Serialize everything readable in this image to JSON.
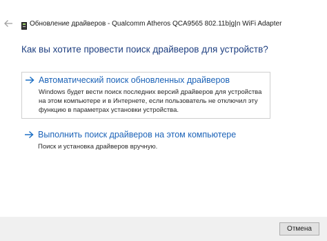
{
  "window": {
    "title": "Обновление драйверов - Qualcomm Atheros QCA9565 802.11b|g|n WiFi Adapter",
    "back_icon": "back-arrow-icon",
    "device_icon": "device-driver-icon"
  },
  "heading": "Как вы хотите провести поиск драйверов для устройств?",
  "options": [
    {
      "icon": "arrow-right-icon",
      "title": "Автоматический поиск обновленных драйверов",
      "description": "Windows будет вести поиск последних версий драйверов для устройства на этом компьютере и в Интернете, если пользователь не отключил эту функцию в параметрах установки устройства."
    },
    {
      "icon": "arrow-right-icon",
      "title": "Выполнить поиск драйверов на этом компьютере",
      "description": "Поиск и установка драйверов вручную."
    }
  ],
  "footer": {
    "cancel_label": "Отмена"
  },
  "colors": {
    "heading": "#1e3f80",
    "link": "#1c63b8",
    "footer_bg": "#f0f0f0"
  }
}
